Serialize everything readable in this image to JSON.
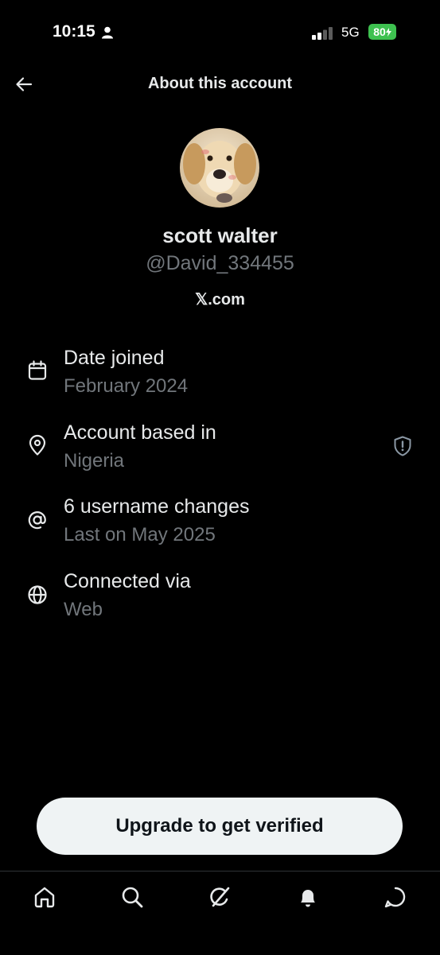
{
  "status_bar": {
    "time": "10:15",
    "network": "5G",
    "battery": "80"
  },
  "header": {
    "title": "About this account"
  },
  "profile": {
    "name": "scott walter",
    "handle": "@David_334455",
    "site": "𝕏.com"
  },
  "details": [
    {
      "icon": "calendar-icon",
      "title": "Date joined",
      "subtitle": "February 2024"
    },
    {
      "icon": "location-pin-icon",
      "title": "Account based in",
      "subtitle": "Nigeria"
    },
    {
      "icon": "at-sign-icon",
      "title": "6 username changes",
      "subtitle": "Last on May 2025"
    },
    {
      "icon": "globe-icon",
      "title": "Connected via",
      "subtitle": "Web"
    }
  ],
  "upgrade": {
    "label": "Upgrade to get verified"
  },
  "tabs": [
    "home-icon",
    "search-icon",
    "grok-icon",
    "notifications-icon",
    "messages-icon"
  ],
  "colors": {
    "background": "#000000",
    "primary_text": "#e7e9ea",
    "secondary_text": "#71767b",
    "battery": "#3ec150",
    "button_bg": "#eff3f4"
  }
}
